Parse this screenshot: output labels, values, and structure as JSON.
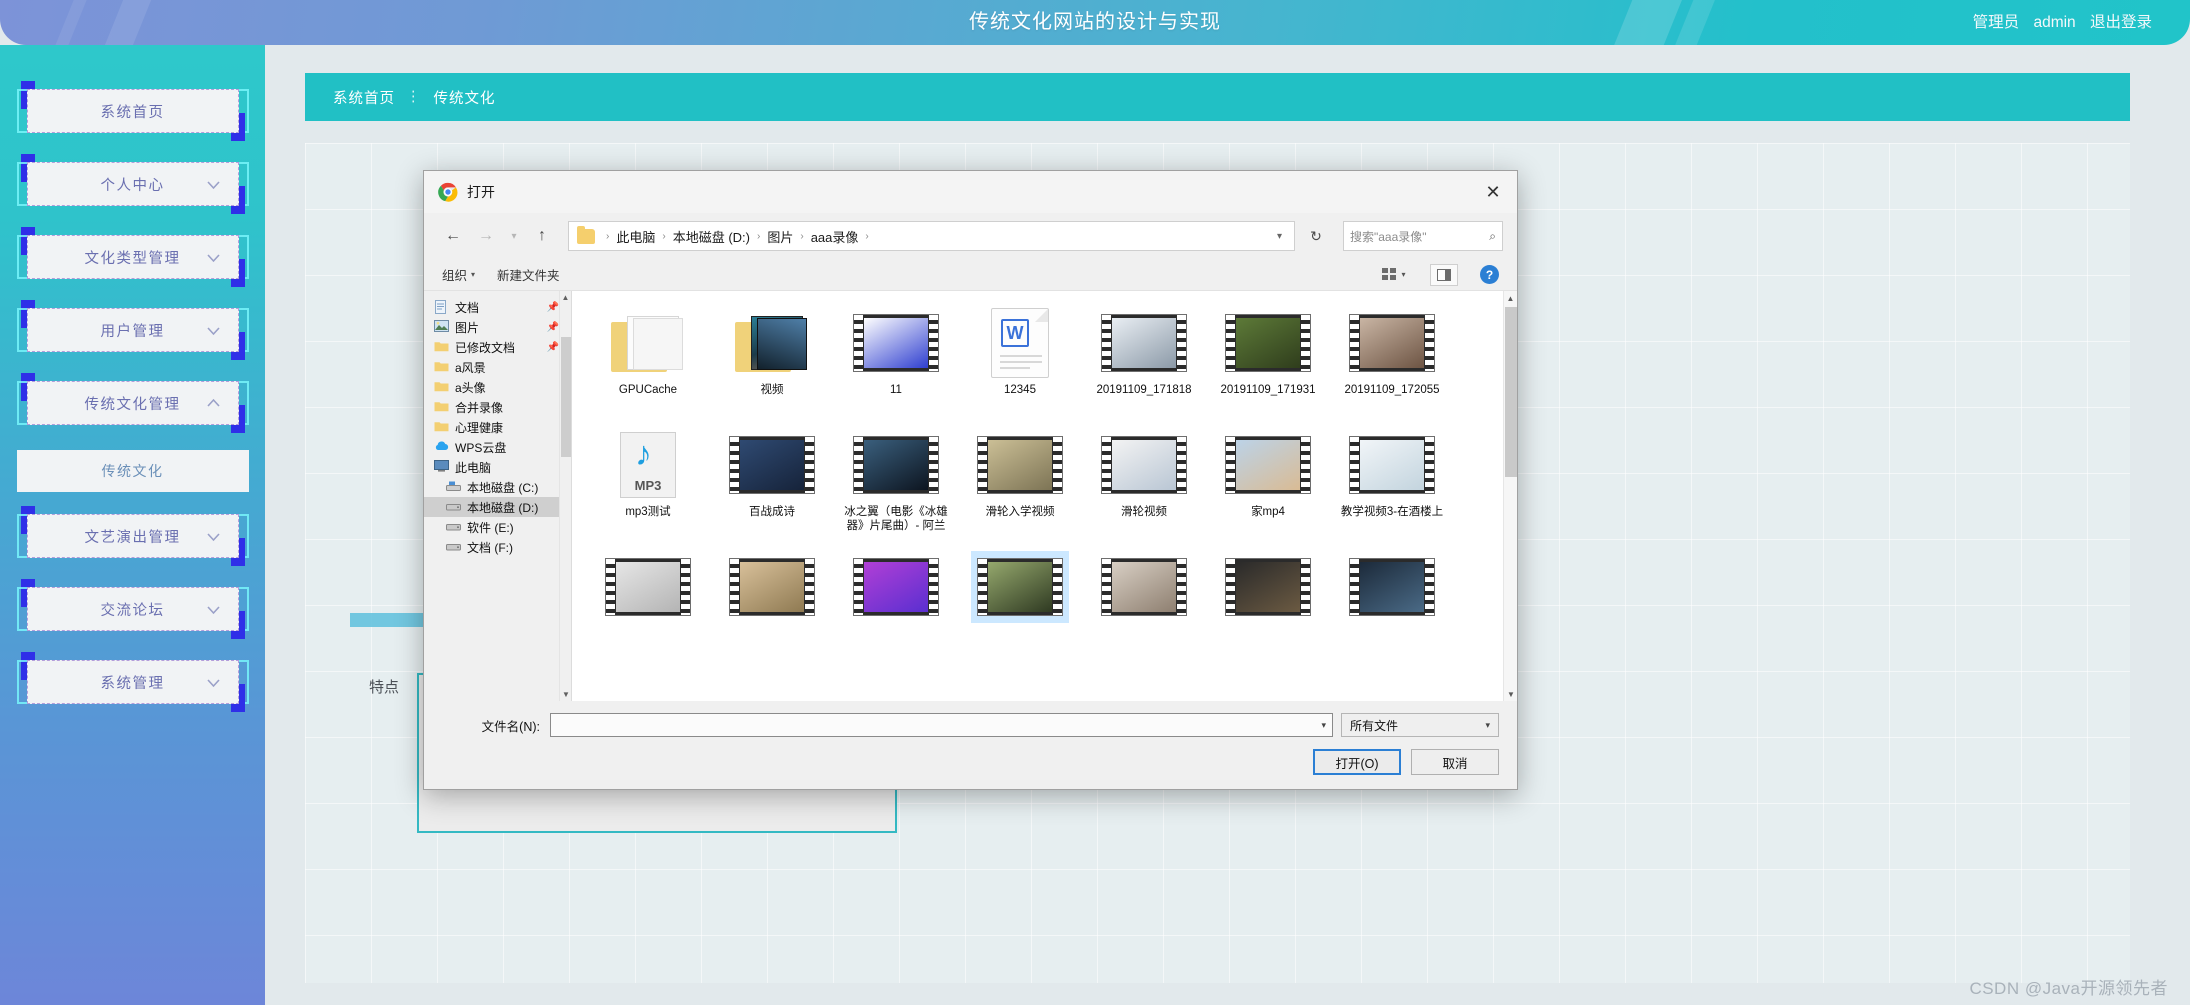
{
  "header": {
    "title": "传统文化网站的设计与实现",
    "role": "管理员",
    "username": "admin",
    "logout": "退出登录"
  },
  "sidebar": {
    "items": [
      {
        "label": "系统首页",
        "chevron": "none"
      },
      {
        "label": "个人中心",
        "chevron": "down"
      },
      {
        "label": "文化类型管理",
        "chevron": "down"
      },
      {
        "label": "用户管理",
        "chevron": "down"
      },
      {
        "label": "传统文化管理",
        "chevron": "up"
      }
    ],
    "submenu": [
      {
        "label": "传统文化"
      }
    ],
    "items_after": [
      {
        "label": "文艺演出管理",
        "chevron": "down"
      },
      {
        "label": "交流论坛",
        "chevron": "down"
      },
      {
        "label": "系统管理",
        "chevron": "down"
      }
    ]
  },
  "breadcrumb": {
    "home": "系统首页",
    "separator": "⋮",
    "current": "传统文化"
  },
  "form": {
    "feature_label": "特点",
    "feature_placeholder": "特点",
    "feature_value": ""
  },
  "watermark": "CSDN @Java开源领先者",
  "dialog": {
    "title": "打开",
    "close_label": "✕",
    "nav": {
      "back": "←",
      "forward": "→",
      "recent": "▾",
      "up": "↑",
      "path": [
        "此电脑",
        "本地磁盘 (D:)",
        "图片",
        "aaa录像"
      ],
      "path_dropdown": "▾",
      "refresh": "↻"
    },
    "search": {
      "placeholder": "搜索\"aaa录像\"",
      "icon": "⌕"
    },
    "toolbar": {
      "organize": "组织",
      "organize_caret": "▾",
      "new_folder": "新建文件夹",
      "help": "?"
    },
    "tree": [
      {
        "label": "文档",
        "icon": "document-icon",
        "pinned": true,
        "selected": false
      },
      {
        "label": "图片",
        "icon": "picture-icon",
        "pinned": true,
        "selected": false
      },
      {
        "label": "已修改文档",
        "icon": "folder-icon",
        "pinned": true,
        "selected": false
      },
      {
        "label": "a风景",
        "icon": "folder-icon",
        "pinned": false,
        "selected": false
      },
      {
        "label": "a头像",
        "icon": "folder-icon",
        "pinned": false,
        "selected": false
      },
      {
        "label": "合并录像",
        "icon": "folder-icon",
        "pinned": false,
        "selected": false
      },
      {
        "label": "心理健康",
        "icon": "folder-icon",
        "pinned": false,
        "selected": false
      },
      {
        "label": "WPS云盘",
        "icon": "cloud-icon",
        "pinned": false,
        "selected": false
      },
      {
        "label": "此电脑",
        "icon": "computer-icon",
        "pinned": false,
        "selected": false
      },
      {
        "label": "本地磁盘 (C:)",
        "icon": "drive-system-icon",
        "pinned": false,
        "selected": false
      },
      {
        "label": "本地磁盘 (D:)",
        "icon": "drive-icon",
        "pinned": false,
        "selected": true
      },
      {
        "label": "软件 (E:)",
        "icon": "drive-icon",
        "pinned": false,
        "selected": false
      },
      {
        "label": "文档 (F:)",
        "icon": "drive-icon",
        "pinned": false,
        "selected": false
      }
    ],
    "files": [
      {
        "name": "GPUCache",
        "kind": "folder-plain",
        "selected": false
      },
      {
        "name": "视频",
        "kind": "folder-photo",
        "selected": false
      },
      {
        "name": "11",
        "kind": "video",
        "selected": false,
        "color1": "#ffffff",
        "color2": "#2f3fd0"
      },
      {
        "name": "12345",
        "kind": "word",
        "selected": false
      },
      {
        "name": "20191109_171818",
        "kind": "video",
        "selected": false,
        "color1": "#e9eef3",
        "color2": "#8c9aa8"
      },
      {
        "name": "20191109_171931",
        "kind": "video",
        "selected": false,
        "color1": "#5d7a38",
        "color2": "#2f3d1c"
      },
      {
        "name": "20191109_172055",
        "kind": "video",
        "selected": false,
        "color1": "#c9b5a4",
        "color2": "#6d5443"
      },
      {
        "name": "mp3测试",
        "kind": "mp3",
        "selected": false
      },
      {
        "name": "百战成诗",
        "kind": "video",
        "selected": false,
        "color1": "#2f4a72",
        "color2": "#16233a"
      },
      {
        "name": "冰之翼（电影《冰雄器》片尾曲）- 阿兰",
        "kind": "video",
        "selected": false,
        "color1": "#3a5f7d",
        "color2": "#0d1520"
      },
      {
        "name": "滑轮入学视频",
        "kind": "video",
        "selected": false,
        "color1": "#cbbf96",
        "color2": "#7d7455"
      },
      {
        "name": "滑轮视频",
        "kind": "video",
        "selected": false,
        "color1": "#f3f3f3",
        "color2": "#b9c6d4"
      },
      {
        "name": "家mp4",
        "kind": "video",
        "selected": false,
        "color1": "#bcd3e8",
        "color2": "#d9bb94"
      },
      {
        "name": "教学视频3-在酒楼上",
        "kind": "video",
        "selected": false,
        "color1": "#f1f5f8",
        "color2": "#c3d4de"
      },
      {
        "name": "",
        "kind": "video",
        "selected": false,
        "color1": "#e6e6e6",
        "color2": "#b4b4b4"
      },
      {
        "name": "",
        "kind": "video",
        "selected": false,
        "color1": "#d8c09a",
        "color2": "#8f7a52"
      },
      {
        "name": "",
        "kind": "video",
        "selected": false,
        "color1": "#b13fd6",
        "color2": "#5a2fd0"
      },
      {
        "name": "",
        "kind": "video",
        "selected": true,
        "color1": "#95a86d",
        "color2": "#2f3a22"
      },
      {
        "name": "",
        "kind": "video",
        "selected": false,
        "color1": "#d8cfc4",
        "color2": "#8e7f70"
      },
      {
        "name": "",
        "kind": "video",
        "selected": false,
        "color1": "#2a2a2a",
        "color2": "#6b5a42"
      },
      {
        "name": "",
        "kind": "video",
        "selected": false,
        "color1": "#1c2a3a",
        "color2": "#4a6a86"
      }
    ],
    "footer": {
      "filename_label": "文件名(N):",
      "filename_value": "",
      "filetype_value": "所有文件",
      "open_button": "打开(O)",
      "cancel_button": "取消"
    }
  }
}
